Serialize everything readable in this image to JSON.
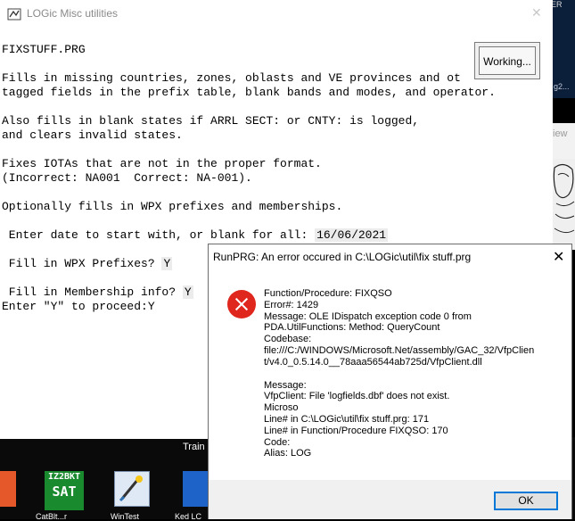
{
  "window": {
    "title": "LOGic Misc utilities",
    "close_glyph": "✕"
  },
  "console": {
    "program": "FIXSTUFF.PRG",
    "lines": [
      "Fills in missing countries, zones, oblasts and VE provinces and ot",
      "tagged fields in the prefix table, blank bands and modes, and operator.",
      "Also fills in blank states if ARRL SECT: or CNTY: is logged,",
      "and clears invalid states.",
      "Fixes IOTAs that are not in the proper format.",
      "(Incorrect: NA001  Correct: NA-001).",
      "Optionally fills in WPX prefixes and memberships."
    ],
    "date_prompt": " Enter date to start with, or blank for all:",
    "date_value": "16/06/2021",
    "wpx_prompt": " Fill in WPX Prefixes?",
    "wpx_value": "Y",
    "membership_prompt": " Fill in Membership info?",
    "membership_value": "Y",
    "proceed_prompt": "Enter \"Y\" to proceed:",
    "proceed_value": "Y"
  },
  "working_button": {
    "label": "Working..."
  },
  "dialog": {
    "title": "RunPRG: An error occured in C:\\LOGic\\util\\fix stuff.prg",
    "close_glyph": "✕",
    "icon": "error-icon",
    "message_lines": [
      "Function/Procedure: FIXQSO",
      "Error#: 1429",
      "Message: OLE IDispatch exception code 0 from",
      "PDA.UtilFunctions: Method: QueryCount",
      "Codebase:",
      "file:///C:/WINDOWS/Microsoft.Net/assembly/GAC_32/VfpClien",
      "t/v4.0_0.5.14.0__78aaa56544ab725d/VfpClient.dll",
      "",
      "Message:",
      "VfpClient: File 'logfields.dbf' does not exist.",
      "Microso",
      "Line# in C:\\LOGic\\util\\fix stuff.prg: 171",
      "Line# in Function/Procedure FIXQSO: 170",
      "Code:",
      "Alias: LOG"
    ],
    "ok_label": "OK"
  },
  "background": {
    "top_right_text": "ER",
    "top_right_text2": "g2...",
    "view_text": "iew",
    "taskbar_label": "Train",
    "icons": [
      {
        "name": "orange-app-icon",
        "label": ""
      },
      {
        "name": "iz2bkt-sat-icon",
        "label": "CatBlt...r",
        "top": "IZ2BKT",
        "bottom": "SAT"
      },
      {
        "name": "wizard-icon",
        "label": "WinTest"
      },
      {
        "name": "blue-app-icon",
        "label": "Ked LC"
      }
    ],
    "colors": {
      "error_red": "#e0271e",
      "ok_border": "#0078d7",
      "desktop_dark": "#0a0a0a"
    }
  }
}
